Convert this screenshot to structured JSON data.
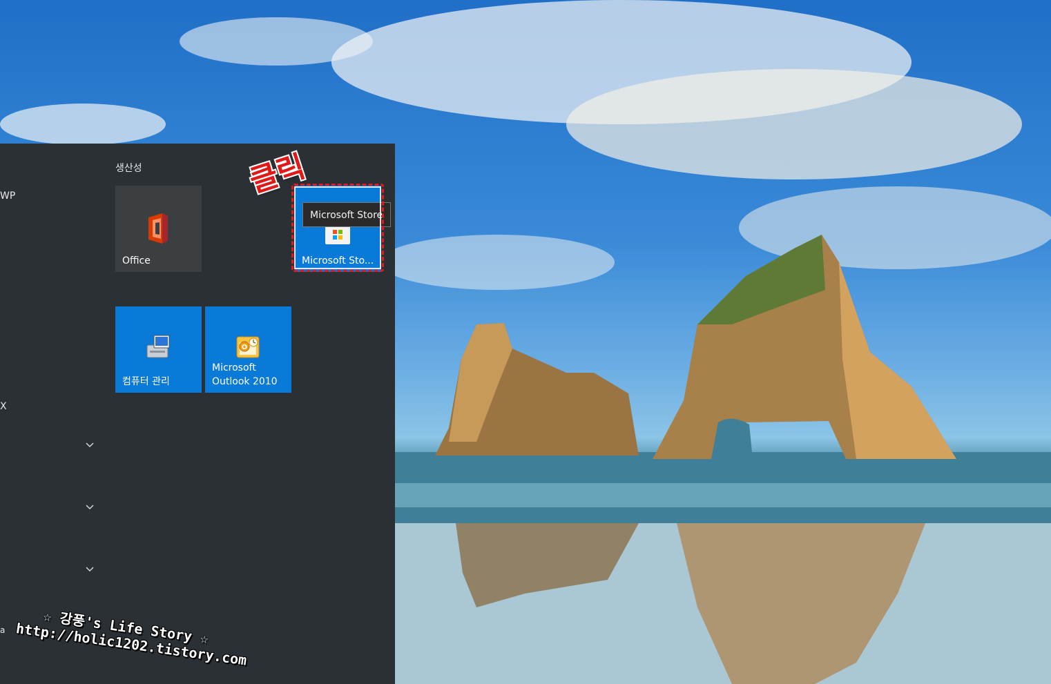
{
  "start_menu": {
    "app_list_fragments": {
      "item_wp": "WP",
      "item_x": "X",
      "item_a": "a"
    },
    "group_title": "생산성",
    "tiles": {
      "office": {
        "label": "Office",
        "icon": "office-icon"
      },
      "computer_management": {
        "label": "컴퓨터 관리",
        "icon": "computer-management-icon"
      },
      "outlook": {
        "label_line1": "Microsoft",
        "label_line2": "Outlook 2010",
        "icon": "outlook-icon"
      },
      "store": {
        "label": "Microsoft Sto...",
        "icon": "store-icon"
      }
    },
    "tooltip": "Microsoft Store"
  },
  "annotations": {
    "click_text": "클릭",
    "highlight_color": "#e51a1a"
  },
  "watermark": {
    "line1": "☆ 강풍's Life Story ☆",
    "line2": "http://holic1202.tistory.com"
  },
  "colors": {
    "panel_bg": "#2b3035",
    "tile_blue": "#0a7ad8",
    "tile_gray": "#3c3f42"
  }
}
